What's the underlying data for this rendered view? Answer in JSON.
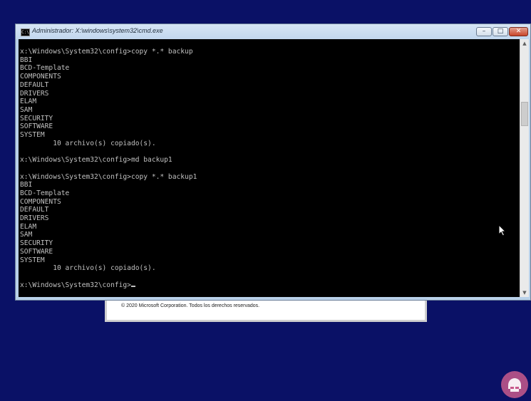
{
  "window": {
    "title": "Administrador: X:\\windows\\system32\\cmd.exe",
    "icon": "cmd-icon",
    "controls": {
      "minimize": "minimize-icon",
      "maximize": "maximize-icon",
      "close": "close-icon"
    }
  },
  "console": {
    "lines": [
      "x:\\Windows\\System32\\config>copy *.* backup",
      "BBI",
      "BCD-Template",
      "COMPONENTS",
      "DEFAULT",
      "DRIVERS",
      "ELAM",
      "SAM",
      "SECURITY",
      "SOFTWARE",
      "SYSTEM",
      "        10 archivo(s) copiado(s).",
      "",
      "x:\\Windows\\System32\\config>md backup1",
      "",
      "x:\\Windows\\System32\\config>copy *.* backup1",
      "BBI",
      "BCD-Template",
      "COMPONENTS",
      "DEFAULT",
      "DRIVERS",
      "ELAM",
      "SAM",
      "SECURITY",
      "SOFTWARE",
      "SYSTEM",
      "        10 archivo(s) copiado(s).",
      ""
    ],
    "prompt": "x:\\Windows\\System32\\config>"
  },
  "setup_dialog": {
    "copyright": "© 2020 Microsoft Corporation. Todos los derechos reservados."
  },
  "colors": {
    "desktop_background": "#0a1166",
    "console_background": "#000000",
    "console_text": "#c0c0c0",
    "title_bar": "#c2d7ee",
    "close_button": "#c9452c"
  }
}
